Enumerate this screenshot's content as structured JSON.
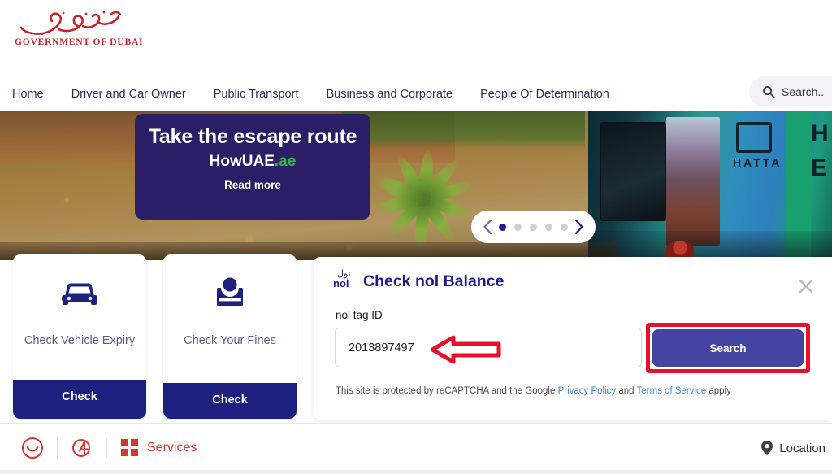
{
  "header": {
    "logo": {
      "arabic": "حكومة دبي",
      "latin": "GOVERNMENT OF DUBAI",
      "color": "#c8232c"
    },
    "nav": [
      {
        "label": "Home"
      },
      {
        "label": "Driver and Car Owner"
      },
      {
        "label": "Public Transport"
      },
      {
        "label": "Business and Corporate"
      },
      {
        "label": "People Of Determination"
      }
    ],
    "search": {
      "label": "Search..",
      "icon": "search-icon"
    }
  },
  "hero": {
    "banner": {
      "title": "Take the escape route",
      "brand_main": "HowUAE",
      "brand_tld": ".ae",
      "tld_color": "#3cb24a",
      "cta": "Read more",
      "background": "#2a1f66"
    },
    "carousel": {
      "prev_icon": "chevron-left-icon",
      "next_icon": "chevron-right-icon",
      "dot_count": 5,
      "active_index": 0,
      "active_color": "#1b1b8f",
      "inactive_color": "#cfcfd6"
    },
    "bus_text": "HATTA"
  },
  "cards": [
    {
      "icon": "car-icon",
      "label": "Check Vehicle Expiry",
      "button": "Check",
      "button_color": "#1e2080"
    },
    {
      "icon": "fines-person-icon",
      "label": "Check Your Fines",
      "button": "Check",
      "button_color": "#1e2080"
    }
  ],
  "modal": {
    "logo": {
      "arabic": "نول",
      "latin": "nol"
    },
    "title": "Check nol Balance",
    "close_icon": "close-icon",
    "field_label": "nol tag ID",
    "input_value": "2013897497",
    "input_placeholder": "nol tag ID",
    "search_button": "Search",
    "search_button_color": "#4445a0",
    "recaptcha": {
      "before": "This site is protected by reCAPTCHA and the Google ",
      "link1": "Privacy Policy",
      "middle": " and ",
      "link2": "Terms of Service",
      "after": " apply",
      "link_color": "#3d7fd4"
    }
  },
  "annotations": {
    "highlight_color": "#e8112d",
    "arrow_direction": "left",
    "highlight_target": "Search"
  },
  "bottom_bar": {
    "smiley_icon": "happiness-meter-icon",
    "accessibility_icon": "accessibility-icon",
    "grid_icon": "grid-icon",
    "services_label": "Services",
    "services_color": "#d6382e",
    "location_icon": "map-pin-icon",
    "location_label": "Location"
  }
}
